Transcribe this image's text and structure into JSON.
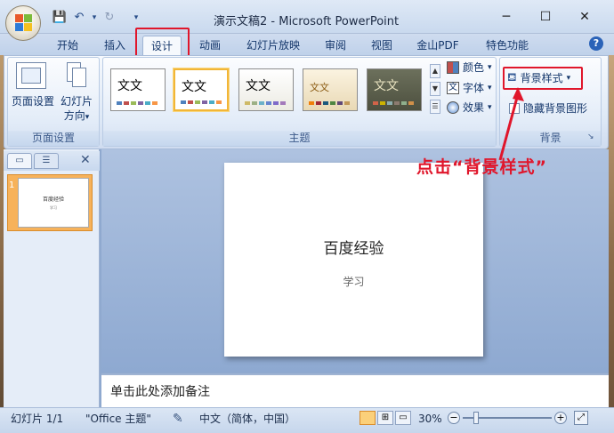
{
  "window": {
    "title": "演示文稿2 - Microsoft PowerPoint",
    "minimize": "─",
    "maximize": "☐",
    "close": "✕"
  },
  "qat": {
    "save": "💾",
    "undo": "↶",
    "undo_arrow": "▾",
    "redo": "↻",
    "customize": "▾"
  },
  "tabs": [
    {
      "label": "开始",
      "active": false
    },
    {
      "label": "插入",
      "active": false
    },
    {
      "label": "设计",
      "active": true
    },
    {
      "label": "动画",
      "active": false
    },
    {
      "label": "幻灯片放映",
      "active": false
    },
    {
      "label": "审阅",
      "active": false
    },
    {
      "label": "视图",
      "active": false
    },
    {
      "label": "金山PDF",
      "active": false
    },
    {
      "label": "特色功能",
      "active": false
    }
  ],
  "help": "?",
  "ribbon": {
    "page_setup_group": {
      "label": "页面设置",
      "page_setup_btn": "页面设置",
      "orientation_btn_1": "幻灯片",
      "orientation_btn_2": "方向",
      "dropdown": "▾"
    },
    "themes_group": {
      "label": "主题",
      "theme_text": "文文",
      "colors": "颜色",
      "fonts": "字体",
      "effects": "效果",
      "dropdown": "▾"
    },
    "background_group": {
      "label": "背景",
      "bg_styles": "背景样式",
      "hide_bg": "隐藏背景图形",
      "dropdown": "▾",
      "launcher": "↘"
    }
  },
  "slide_panel": {
    "outline_tab_icon": "☰",
    "slides_tab_icon": "▭",
    "close": "✕",
    "slide_number": "1",
    "thumb_title": "百度经验",
    "thumb_sub": "学习"
  },
  "slide": {
    "title": "百度经验",
    "subtitle": "学习"
  },
  "notes": {
    "placeholder": "单击此处添加备注"
  },
  "status": {
    "slide_count": "幻灯片 1/1",
    "theme": "\"Office 主题\"",
    "language": "中文（简体，中国）",
    "zoom": "30%",
    "zoom_minus": "−",
    "zoom_plus": "+"
  },
  "annotation": "点击“背景样式”",
  "colors": {
    "annotation": "#e0162b",
    "accent": "#2b63b8"
  }
}
